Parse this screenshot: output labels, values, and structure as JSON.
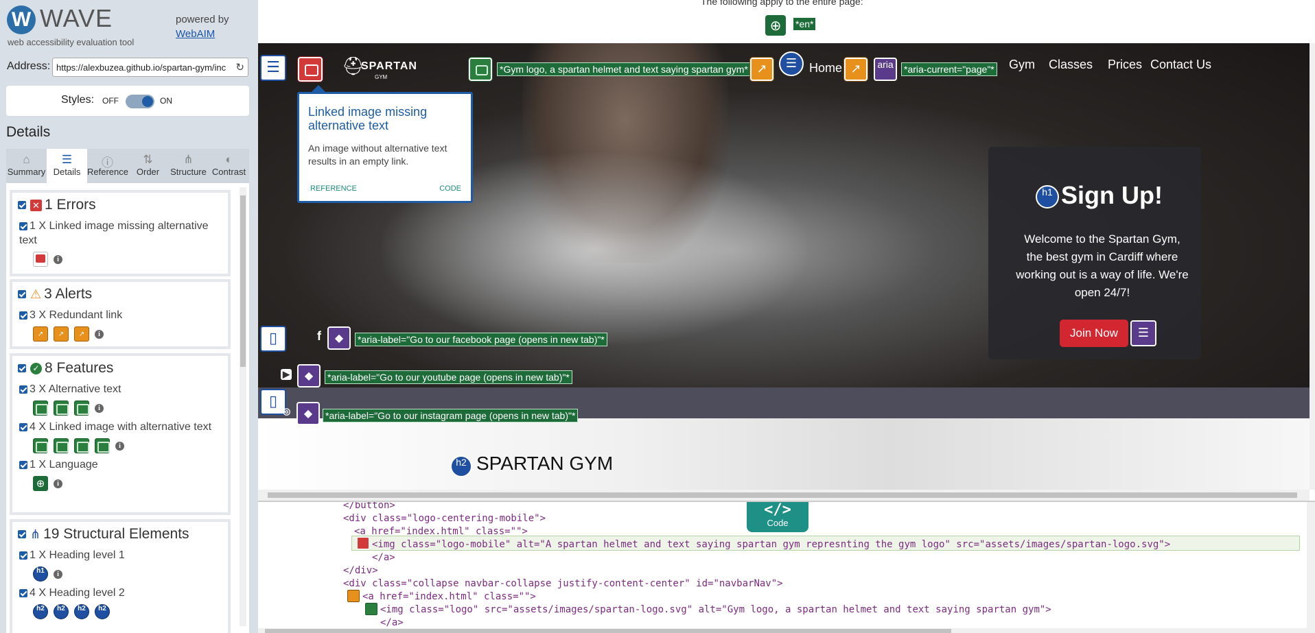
{
  "app": {
    "logo_letter": "W",
    "name": "WAVE",
    "subtitle": "web accessibility evaluation tool",
    "powered_by": "powered by",
    "webaim_link": "WebAIM"
  },
  "address": {
    "label": "Address:",
    "value": "https://alexbuzea.github.io/spartan-gym/inc"
  },
  "styles": {
    "label": "Styles:",
    "off": "OFF",
    "on": "ON",
    "state": "on"
  },
  "details_heading": "Details",
  "tabs": [
    {
      "label": "Summary",
      "icon": "home-icon"
    },
    {
      "label": "Details",
      "icon": "list-icon",
      "active": true
    },
    {
      "label": "Reference",
      "icon": "info-icon"
    },
    {
      "label": "Order",
      "icon": "order-icon"
    },
    {
      "label": "Structure",
      "icon": "structure-icon"
    },
    {
      "label": "Contrast",
      "icon": "contrast-icon"
    }
  ],
  "categories": {
    "errors": {
      "title": "1 Errors",
      "items": [
        {
          "label": "1 X Linked image missing alternative text",
          "count": 1
        }
      ]
    },
    "alerts": {
      "title": "3 Alerts",
      "items": [
        {
          "label": "3 X Redundant link",
          "count": 3
        }
      ]
    },
    "features": {
      "title": "8 Features",
      "items": [
        {
          "label": "3 X Alternative text",
          "count": 3
        },
        {
          "label": "4 X Linked image with alternative text",
          "count": 4
        },
        {
          "label": "1 X Language",
          "count": 1
        }
      ]
    },
    "structure": {
      "title": "19 Structural Elements",
      "items": [
        {
          "label": "1 X Heading level 1",
          "count": 1,
          "badge": "h1"
        },
        {
          "label": "4 X Heading level 2",
          "count": 4,
          "badge": "h2"
        }
      ]
    }
  },
  "page": {
    "apply_text": "The following apply to the entire page:",
    "lang_tag": "*en*",
    "logo": {
      "name": "SPARTAN",
      "sub": "GYM"
    },
    "logo_alt_label": "*Gym logo, a spartan helmet and text saying spartan gym*",
    "home_link": "Home",
    "aria_badge": "aria",
    "aria_current_label": "*aria-current=\"page\"*",
    "nav": [
      "Gym",
      "Classes",
      "Prices",
      "Contact Us"
    ],
    "tooltip": {
      "title": "Linked image missing alternative text",
      "body": "An image without alternative text results in an empty link.",
      "reference": "REFERENCE",
      "code": "CODE"
    },
    "signup": {
      "h1_badge": "h1",
      "title": "Sign Up!",
      "text": "Welcome to the Spartan Gym, the best gym in Cardiff where working out is a way of life. We're open 24/7!",
      "button": "Join Now"
    },
    "social": [
      {
        "glyph": "f",
        "label": "*aria-label=\"Go to our facebook page (opens in new tab)\"*"
      },
      {
        "glyph": "▶",
        "label": "*aria-label=\"Go to our youtube page (opens in new tab)\"*"
      },
      {
        "glyph": "◎",
        "label": "*aria-label=\"Go to our instagram page (opens in new tab)\"*"
      }
    ],
    "h2_badge": "h2",
    "h2_text": "SPARTAN GYM"
  },
  "code_panel": {
    "tab_symbol": "</>",
    "tab_label": "Code",
    "lines": [
      "</button>",
      "<div class=\"logo-centering-mobile\">",
      "<a href=\"index.html\" class=\"\">",
      "<img class=\"logo-mobile\" alt=\"A spartan helmet and text saying spartan gym represnting the gym logo\" src=\"assets/images/spartan-logo.svg\">",
      "</a>",
      "</div>",
      "<div class=\"collapse navbar-collapse justify-content-center\" id=\"navbarNav\">",
      "<a href=\"index.html\" class=\"\">",
      "<img class=\"logo\" src=\"assets/images/spartan-logo.svg\" alt=\"Gym logo, a spartan helmet and text saying spartan gym\">",
      "</a>"
    ]
  },
  "colors": {
    "accent": "#1e5da6",
    "error": "#d23a3a",
    "alert": "#e8901c",
    "feature": "#2a7f3e",
    "aria": "#5a3a8a",
    "code_tab": "#1f9086"
  }
}
